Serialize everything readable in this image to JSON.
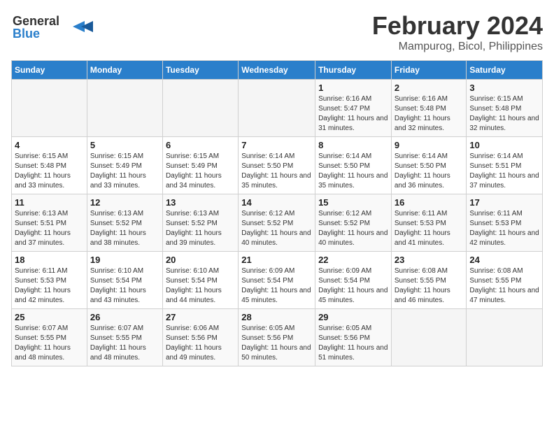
{
  "logo": {
    "line1": "General",
    "line2": "Blue"
  },
  "title": "February 2024",
  "subtitle": "Mampurog, Bicol, Philippines",
  "days_of_week": [
    "Sunday",
    "Monday",
    "Tuesday",
    "Wednesday",
    "Thursday",
    "Friday",
    "Saturday"
  ],
  "weeks": [
    [
      {
        "day": "",
        "info": ""
      },
      {
        "day": "",
        "info": ""
      },
      {
        "day": "",
        "info": ""
      },
      {
        "day": "",
        "info": ""
      },
      {
        "day": "1",
        "info": "Sunrise: 6:16 AM\nSunset: 5:47 PM\nDaylight: 11 hours and 31 minutes."
      },
      {
        "day": "2",
        "info": "Sunrise: 6:16 AM\nSunset: 5:48 PM\nDaylight: 11 hours and 32 minutes."
      },
      {
        "day": "3",
        "info": "Sunrise: 6:15 AM\nSunset: 5:48 PM\nDaylight: 11 hours and 32 minutes."
      }
    ],
    [
      {
        "day": "4",
        "info": "Sunrise: 6:15 AM\nSunset: 5:48 PM\nDaylight: 11 hours and 33 minutes."
      },
      {
        "day": "5",
        "info": "Sunrise: 6:15 AM\nSunset: 5:49 PM\nDaylight: 11 hours and 33 minutes."
      },
      {
        "day": "6",
        "info": "Sunrise: 6:15 AM\nSunset: 5:49 PM\nDaylight: 11 hours and 34 minutes."
      },
      {
        "day": "7",
        "info": "Sunrise: 6:14 AM\nSunset: 5:50 PM\nDaylight: 11 hours and 35 minutes."
      },
      {
        "day": "8",
        "info": "Sunrise: 6:14 AM\nSunset: 5:50 PM\nDaylight: 11 hours and 35 minutes."
      },
      {
        "day": "9",
        "info": "Sunrise: 6:14 AM\nSunset: 5:50 PM\nDaylight: 11 hours and 36 minutes."
      },
      {
        "day": "10",
        "info": "Sunrise: 6:14 AM\nSunset: 5:51 PM\nDaylight: 11 hours and 37 minutes."
      }
    ],
    [
      {
        "day": "11",
        "info": "Sunrise: 6:13 AM\nSunset: 5:51 PM\nDaylight: 11 hours and 37 minutes."
      },
      {
        "day": "12",
        "info": "Sunrise: 6:13 AM\nSunset: 5:52 PM\nDaylight: 11 hours and 38 minutes."
      },
      {
        "day": "13",
        "info": "Sunrise: 6:13 AM\nSunset: 5:52 PM\nDaylight: 11 hours and 39 minutes."
      },
      {
        "day": "14",
        "info": "Sunrise: 6:12 AM\nSunset: 5:52 PM\nDaylight: 11 hours and 40 minutes."
      },
      {
        "day": "15",
        "info": "Sunrise: 6:12 AM\nSunset: 5:52 PM\nDaylight: 11 hours and 40 minutes."
      },
      {
        "day": "16",
        "info": "Sunrise: 6:11 AM\nSunset: 5:53 PM\nDaylight: 11 hours and 41 minutes."
      },
      {
        "day": "17",
        "info": "Sunrise: 6:11 AM\nSunset: 5:53 PM\nDaylight: 11 hours and 42 minutes."
      }
    ],
    [
      {
        "day": "18",
        "info": "Sunrise: 6:11 AM\nSunset: 5:53 PM\nDaylight: 11 hours and 42 minutes."
      },
      {
        "day": "19",
        "info": "Sunrise: 6:10 AM\nSunset: 5:54 PM\nDaylight: 11 hours and 43 minutes."
      },
      {
        "day": "20",
        "info": "Sunrise: 6:10 AM\nSunset: 5:54 PM\nDaylight: 11 hours and 44 minutes."
      },
      {
        "day": "21",
        "info": "Sunrise: 6:09 AM\nSunset: 5:54 PM\nDaylight: 11 hours and 45 minutes."
      },
      {
        "day": "22",
        "info": "Sunrise: 6:09 AM\nSunset: 5:54 PM\nDaylight: 11 hours and 45 minutes."
      },
      {
        "day": "23",
        "info": "Sunrise: 6:08 AM\nSunset: 5:55 PM\nDaylight: 11 hours and 46 minutes."
      },
      {
        "day": "24",
        "info": "Sunrise: 6:08 AM\nSunset: 5:55 PM\nDaylight: 11 hours and 47 minutes."
      }
    ],
    [
      {
        "day": "25",
        "info": "Sunrise: 6:07 AM\nSunset: 5:55 PM\nDaylight: 11 hours and 48 minutes."
      },
      {
        "day": "26",
        "info": "Sunrise: 6:07 AM\nSunset: 5:55 PM\nDaylight: 11 hours and 48 minutes."
      },
      {
        "day": "27",
        "info": "Sunrise: 6:06 AM\nSunset: 5:56 PM\nDaylight: 11 hours and 49 minutes."
      },
      {
        "day": "28",
        "info": "Sunrise: 6:05 AM\nSunset: 5:56 PM\nDaylight: 11 hours and 50 minutes."
      },
      {
        "day": "29",
        "info": "Sunrise: 6:05 AM\nSunset: 5:56 PM\nDaylight: 11 hours and 51 minutes."
      },
      {
        "day": "",
        "info": ""
      },
      {
        "day": "",
        "info": ""
      }
    ]
  ]
}
